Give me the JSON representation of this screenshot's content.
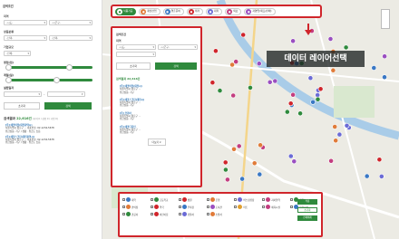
{
  "sidebar": {
    "title": "검색조건",
    "region": {
      "label": "지역",
      "sido": "-시도-",
      "sigungu": "-시군구-"
    },
    "product": {
      "label": "상품분류",
      "sel1": "-선택-",
      "sel2": "-선택-"
    },
    "type": {
      "label": "기업규모",
      "sel": "-전체-"
    },
    "rate": {
      "label": "평점(점)",
      "value": 0.7
    },
    "fee": {
      "label": "계절(일)",
      "value": 0.55
    },
    "period": {
      "label": "설립일자"
    },
    "reset": "초기화",
    "search": "검색",
    "result": {
      "prefix": "검색결과",
      "count": "22,616건",
      "note": "(지역 0 / 상품 0 / 기업 0)"
    },
    "items": [
      {
        "title": "[주] 에코비전(대전광역시)",
        "addr": "서울특별시 종로구 ··· 대표번호: 02-1234-5678",
        "info": "취급상품: 가구 / 생활 · 취급도 높음"
      },
      {
        "title": "[주] 에코스크린(대전광역시)",
        "addr": "서울특별시 종로구 ··· 대표번호: 02-1234-5678",
        "info": "취급상품: 가구 / 생활 · 취급도 높음"
      }
    ]
  },
  "tabs": [
    {
      "label": "식품가공",
      "on": true,
      "color": "#2f8a3d"
    },
    {
      "label": "재생산업",
      "color": "#e07b39"
    },
    {
      "label": "결혼준비",
      "color": "#3a78c4"
    },
    {
      "label": "레저",
      "color": "#d0252b"
    },
    {
      "label": "대학",
      "color": "#6b6bd6"
    },
    {
      "label": "의료",
      "color": "#c33e80"
    },
    {
      "label": "자영업(제조/판매)",
      "color": "#9a4fc0"
    }
  ],
  "popup": {
    "title": "검색조건",
    "region": "지역",
    "sido": "-시도-",
    "sigungu": "-시군구-",
    "reset": "초기화",
    "search": "검색",
    "result": "검색결과 22,616건",
    "items": [
      {
        "title": "[주] 에코비전(대전시)",
        "addr": "서울특별시 종로구 ···",
        "info": "취급상품: 가구"
      },
      {
        "title": "[주] 에코스크린(대전시)",
        "addr": "서울특별시 종로구 ···",
        "info": "취급상품: 가구"
      },
      {
        "title": "[주] 코리아",
        "addr": "서울특별시 종로구 ···",
        "info": "취급상품: 가구"
      },
      {
        "title": "[주] 에코디자인",
        "addr": "서울특별시 종로구 ···",
        "info": "취급상품: 가구"
      }
    ],
    "more": "더보기 ▾"
  },
  "caption": "데이터 레이어선택",
  "legend": {
    "items": [
      {
        "label": "대학",
        "color": "#3a78c4"
      },
      {
        "label": "고등학교",
        "color": "#2f8a3d"
      },
      {
        "label": "병원",
        "color": "#d0252b"
      },
      {
        "label": "은행",
        "color": "#e07b39"
      },
      {
        "label": "버스정류장",
        "color": "#6b6bd6"
      },
      {
        "label": "지하철역",
        "color": "#c33e80"
      },
      {
        "label": "공원",
        "color": "#2f8a3d"
      },
      {
        "label": "편의점",
        "color": "#e07b39"
      },
      {
        "label": "약국",
        "color": "#d0252b"
      },
      {
        "label": "주차장",
        "color": "#3a78c4"
      },
      {
        "label": "도서관",
        "color": "#9a4fc0"
      },
      {
        "label": "마트",
        "color": "#e0a030"
      },
      {
        "label": "체육시설",
        "color": "#c33e80"
      },
      {
        "label": "문화시설",
        "color": "#3a78c4"
      },
      {
        "label": "관공서",
        "color": "#2f8a3d"
      },
      {
        "label": "어린이집",
        "color": "#d0252b"
      },
      {
        "label": "경찰서",
        "color": "#6b6bd6"
      },
      {
        "label": "소방서",
        "color": "#e07b39"
      }
    ],
    "buttons": [
      "적용",
      "초기화",
      "전체해제"
    ]
  }
}
